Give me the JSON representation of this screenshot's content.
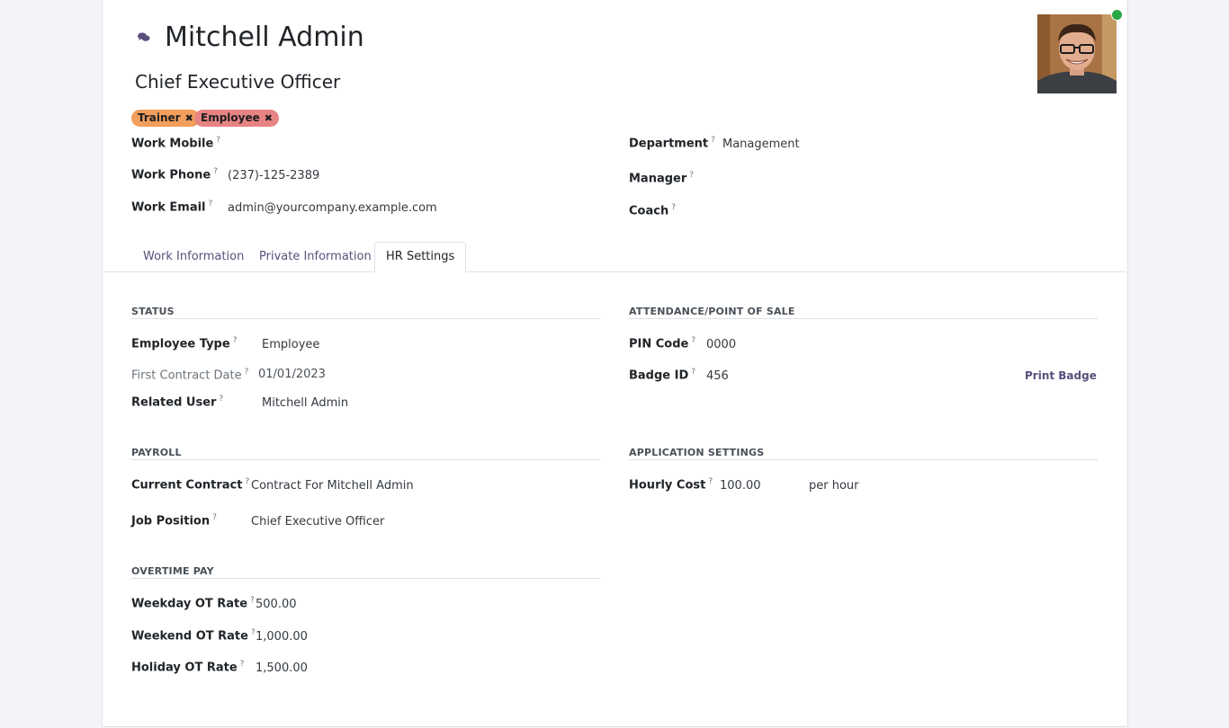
{
  "employee": {
    "name": "Mitchell Admin",
    "job_title": "Chief Executive Officer",
    "tags": [
      {
        "label": "Trainer",
        "color": "#f29e5c"
      },
      {
        "label": "Employee",
        "color": "#e88383"
      }
    ]
  },
  "contact": {
    "work_mobile": {
      "label": "Work Mobile",
      "value": ""
    },
    "work_phone": {
      "label": "Work Phone",
      "value": "(237)-125-2389"
    },
    "work_email": {
      "label": "Work Email",
      "value": "admin@yourcompany.example.com"
    }
  },
  "org": {
    "department": {
      "label": "Department",
      "value": "Management"
    },
    "manager": {
      "label": "Manager",
      "value": ""
    },
    "coach": {
      "label": "Coach",
      "value": ""
    }
  },
  "tabs": [
    {
      "label": "Work Information"
    },
    {
      "label": "Private Information"
    },
    {
      "label": "HR Settings",
      "active": true
    }
  ],
  "status": {
    "title": "STATUS",
    "employee_type": {
      "label": "Employee Type",
      "value": "Employee"
    },
    "first_contract_date": {
      "label": "First Contract Date",
      "value": "01/01/2023"
    },
    "related_user": {
      "label": "Related User",
      "value": "Mitchell Admin"
    }
  },
  "attendance": {
    "title": "ATTENDANCE/POINT OF SALE",
    "pin_code": {
      "label": "PIN Code",
      "value": "0000"
    },
    "badge_id": {
      "label": "Badge ID",
      "value": "456"
    },
    "print_badge": "Print Badge"
  },
  "payroll": {
    "title": "PAYROLL",
    "current_contract": {
      "label": "Current Contract",
      "value": "Contract For Mitchell Admin"
    },
    "job_position": {
      "label": "Job Position",
      "value": "Chief Executive Officer"
    }
  },
  "application": {
    "title": "APPLICATION SETTINGS",
    "hourly_cost": {
      "label": "Hourly Cost",
      "value": "100.00",
      "unit": "per hour"
    }
  },
  "overtime": {
    "title": "OVERTIME PAY",
    "weekday": {
      "label": "Weekday OT Rate",
      "value": "500.00"
    },
    "weekend": {
      "label": "Weekend OT Rate",
      "value": "1,000.00"
    },
    "holiday": {
      "label": "Holiday OT Rate",
      "value": "1,500.00"
    }
  },
  "help_mark": "?",
  "icons": {
    "chat": "chat-bubbles-icon",
    "remove": "close-icon",
    "presence": "online-status-icon"
  },
  "colors": {
    "accent": "#5a4f7c",
    "online": "#28a745"
  }
}
